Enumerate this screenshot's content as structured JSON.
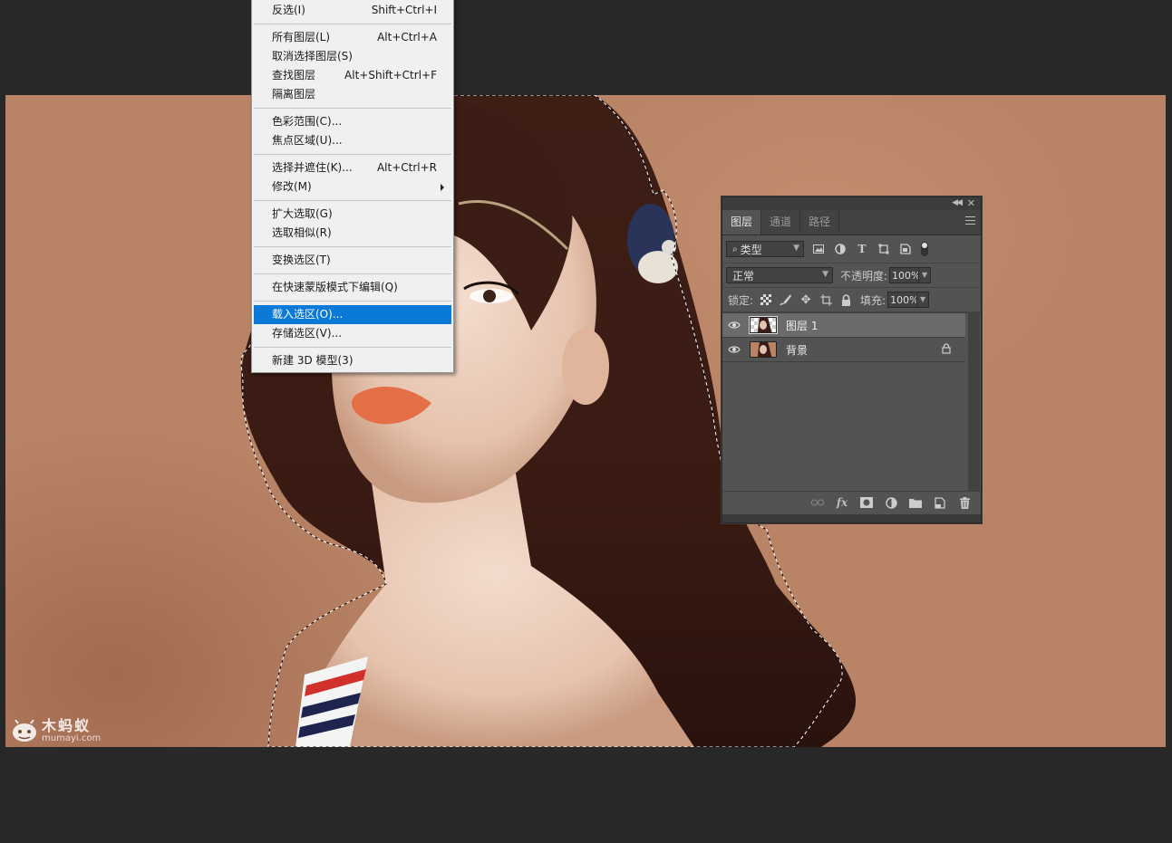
{
  "menu": {
    "items": [
      {
        "label": "反选(I)",
        "shortcut": "Shift+Ctrl+I"
      },
      {
        "label": "所有图层(L)",
        "shortcut": "Alt+Ctrl+A"
      },
      {
        "label": "取消选择图层(S)",
        "shortcut": ""
      },
      {
        "label": "查找图层",
        "shortcut": "Alt+Shift+Ctrl+F"
      },
      {
        "label": "隔离图层",
        "shortcut": ""
      },
      {
        "label": "色彩范围(C)...",
        "shortcut": ""
      },
      {
        "label": "焦点区域(U)...",
        "shortcut": ""
      },
      {
        "label": "选择并遮住(K)...",
        "shortcut": "Alt+Ctrl+R"
      },
      {
        "label": "修改(M)",
        "shortcut": ""
      },
      {
        "label": "扩大选取(G)",
        "shortcut": ""
      },
      {
        "label": "选取相似(R)",
        "shortcut": ""
      },
      {
        "label": "变换选区(T)",
        "shortcut": ""
      },
      {
        "label": "在快速蒙版模式下编辑(Q)",
        "shortcut": ""
      },
      {
        "label": "载入选区(O)...",
        "shortcut": ""
      },
      {
        "label": "存储选区(V)...",
        "shortcut": ""
      },
      {
        "label": "新建 3D 模型(3)",
        "shortcut": ""
      }
    ],
    "active_label": "载入选区(O)..."
  },
  "layers_panel": {
    "tabs": [
      "图层",
      "通道",
      "路径"
    ],
    "active_tab": "图层",
    "filter_kind": "类型",
    "blend_mode": "正常",
    "opacity_label": "不透明度:",
    "opacity_value": "100%",
    "lock_label": "锁定:",
    "fill_label": "填充:",
    "fill_value": "100%",
    "layers": [
      {
        "name": "图层 1",
        "visible": true,
        "selected": true,
        "locked": false
      },
      {
        "name": "背景",
        "visible": true,
        "selected": false,
        "locked": true
      }
    ],
    "icons": {
      "filter": [
        "image-filter-icon",
        "adjustment-filter-icon",
        "type-filter-icon",
        "shape-filter-icon",
        "smart-object-filter-icon"
      ],
      "lock": [
        "lock-transparent-pixels-icon",
        "lock-image-pixels-icon",
        "lock-position-icon",
        "lock-artboard-icon",
        "lock-all-icon"
      ],
      "bottom": [
        "link-layers-icon",
        "fx-icon",
        "add-mask-icon",
        "new-adjustment-icon",
        "new-group-icon",
        "new-layer-icon",
        "delete-layer-icon"
      ]
    }
  },
  "watermark": {
    "main": "木蚂蚁",
    "sub": "mumayi.com"
  },
  "colors": {
    "canvas_bg": "#b98466",
    "app_bg": "#282828",
    "menu_highlight": "#0a79d8",
    "panel_bg": "#535353"
  }
}
